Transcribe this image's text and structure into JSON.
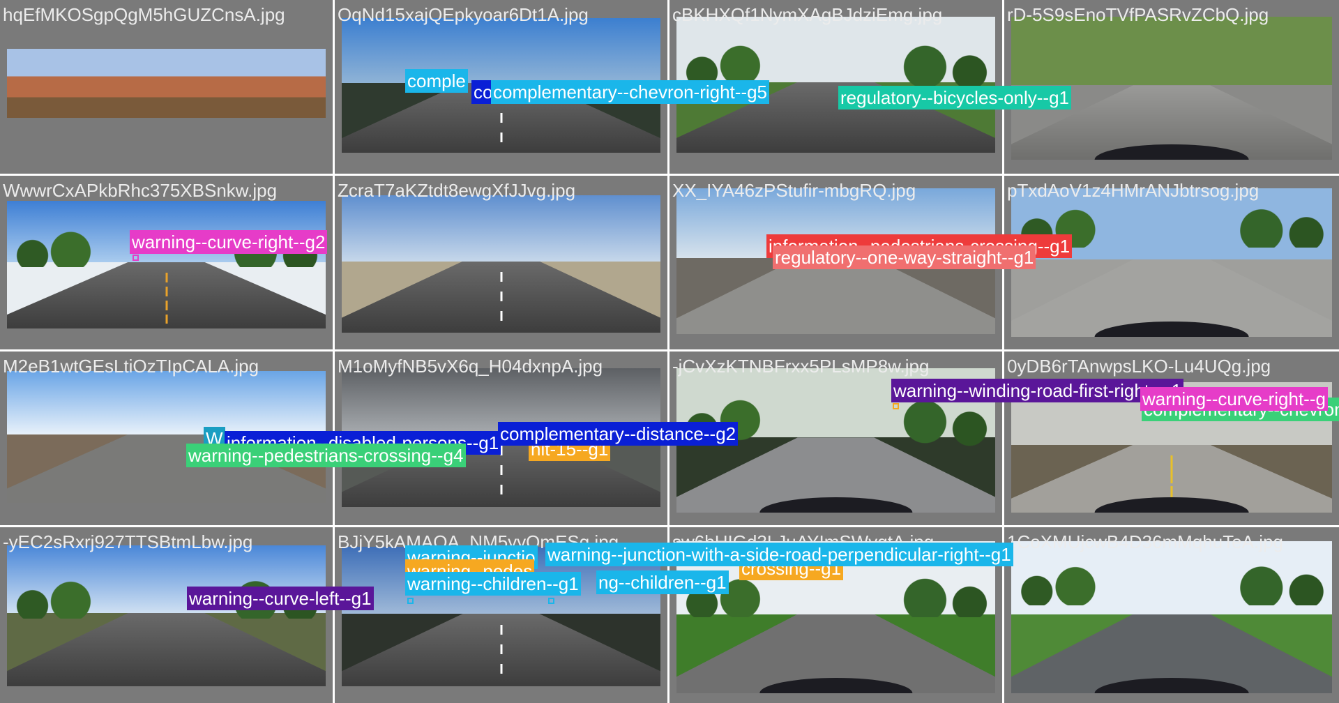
{
  "colors": {
    "complementary": "#1ab6ea",
    "complementary_dark": "#0a1fd6",
    "regulatory_green": "#17c9a6",
    "warning_pink": "#e63cc8",
    "information_red": "#ee3b3b",
    "regulatory_salmon": "#f06f6f",
    "warning_purple": "#5a1699",
    "warning_green": "#3ad078",
    "info_teal": "#1a9ec2",
    "orange": "#f6a821",
    "cell_bg": "#7a7a7a"
  },
  "cells": [
    {
      "filename": "hqEfMKOSgpQgM5hGUZCnsA.jpg",
      "scene": "panorama"
    },
    {
      "filename": "OqNd15xajQEpkyoar6Dt1A.jpg",
      "scene": "highway-dusk"
    },
    {
      "filename": "cBKHXQf1NymXAgBJdziEmg.jpg",
      "scene": "tree-road"
    },
    {
      "filename": "rD-5S9sEnoTVfPASRvZCbQ.jpg",
      "scene": "residential"
    },
    {
      "filename": "WwwrCxAPkbRhc375XBSnkw.jpg",
      "scene": "snow-road"
    },
    {
      "filename": "ZcraT7aKZtdt8ewgXfJJvg.jpg",
      "scene": "rocky-highway"
    },
    {
      "filename": "XX_IYA46zPStufir-mbgRQ.jpg",
      "scene": "town-corner"
    },
    {
      "filename": "pTxdAoV1z4HMrANJbtrsog.jpg",
      "scene": "residential-truck"
    },
    {
      "filename": "M2eB1wtGEsLtiOzTIpCALA.jpg",
      "scene": "town-street"
    },
    {
      "filename": "M1oMyfNB5vX6q_H04dxnpA.jpg",
      "scene": "cloudy-highway"
    },
    {
      "filename": "-jCvXzKTNBFrxx5PLsMP8w.jpg",
      "scene": "shaded-road"
    },
    {
      "filename": "0yDB6rTAnwpsLKO-Lu4UQg.jpg",
      "scene": "yellow-line-road"
    },
    {
      "filename": "-yEC2sRxrj927TTSBtmLbw.jpg",
      "scene": "village-road"
    },
    {
      "filename": "BJjY5kAMAQA_NM5yyQmESg.jpg",
      "scene": "highway-evening"
    },
    {
      "filename": "sw6bHIGd3LJuAYImSWvgtA.jpg",
      "scene": "park-path"
    },
    {
      "filename": "1CoXMUjcwB4D36mMqhuTeA.jpg",
      "scene": "suburb"
    }
  ],
  "labels": [
    {
      "text": "comple",
      "color": "#1ab6ea"
    },
    {
      "text": "co",
      "color": "#0a1fd6"
    },
    {
      "text": "complementary--chevron-right--g5",
      "color": "#1ab6ea"
    },
    {
      "text": "regulatory--bicycles-only--g1",
      "color": "#17c9a6"
    },
    {
      "text": "warning--curve-right--g2",
      "color": "#e63cc8"
    },
    {
      "text": "information--pedestrians-crossing--g1",
      "color": "#ee3b3b"
    },
    {
      "text": "regulatory--one-way-straight--g1",
      "color": "#f06f6f"
    },
    {
      "text": "W",
      "color": "#1a9ec2"
    },
    {
      "text": "information--disabled-persons--g1",
      "color": "#0a1fd6"
    },
    {
      "text": "nit-15--g1",
      "color": "#f6a821"
    },
    {
      "text": "complementary--distance--g2",
      "color": "#0a1fd6"
    },
    {
      "text": "warning--pedestrians-crossing--g4",
      "color": "#3ad078"
    },
    {
      "text": "warning--winding-road-first-right--g1",
      "color": "#5a1699"
    },
    {
      "text": "warning--curve-right--g",
      "color": "#e63cc8"
    },
    {
      "text": "complementary--chevron-right",
      "color": "#3ad078"
    },
    {
      "text": "warning--curve-left--g1",
      "color": "#5a1699"
    },
    {
      "text": "warning--junctio",
      "color": "#1ab6ea"
    },
    {
      "text": "warning--pedes",
      "color": "#f6a821"
    },
    {
      "text": "warning--junction-with-a-side-road-perpendicular-right--g1",
      "color": "#1ab6ea"
    },
    {
      "text": "crossing--g1",
      "color": "#f6a821"
    },
    {
      "text": "warning--children--g1",
      "color": "#1ab6ea"
    },
    {
      "text": "ng--children--g1",
      "color": "#1ab6ea"
    }
  ]
}
